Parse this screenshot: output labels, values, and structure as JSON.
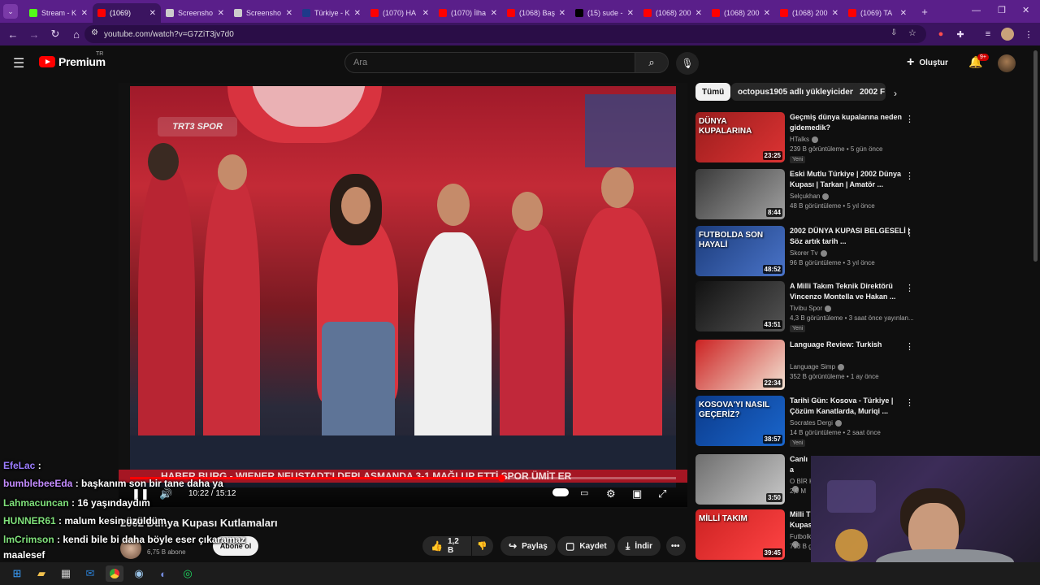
{
  "browser": {
    "tabs": [
      {
        "title": "Stream - K",
        "color": "#53fc18"
      },
      {
        "title": "(1069)",
        "color": "#ff0000",
        "active": true
      },
      {
        "title": "Screensho",
        "color": "#cccccc"
      },
      {
        "title": "Screensho",
        "color": "#cccccc"
      },
      {
        "title": "Türkiye - K",
        "color": "#1e3a8a"
      },
      {
        "title": "(1070) HA",
        "color": "#ff0000"
      },
      {
        "title": "(1070) İlha",
        "color": "#ff0000"
      },
      {
        "title": "(1068) Baş",
        "color": "#ff0000"
      },
      {
        "title": "(15) sude -",
        "color": "#000000"
      },
      {
        "title": "(1068) 200",
        "color": "#ff0000"
      },
      {
        "title": "(1068) 200",
        "color": "#ff0000"
      },
      {
        "title": "(1068) 200",
        "color": "#ff0000"
      },
      {
        "title": "(1069) TA",
        "color": "#ff0000"
      }
    ],
    "url": "youtube.com/watch?v=G7ZiT3jv7d0"
  },
  "header": {
    "logo_text": "Premium",
    "region": "TR",
    "search_placeholder": "Ara",
    "create_label": "Oluştur",
    "notif_badge": "9+"
  },
  "player": {
    "channel_logo": "TRT3 SPOR",
    "ticker": "HABER BURG - WIENER NEUSTADT'I DEPLASMANDA 3-1 MAĞLUP ETTİ   SPOR   ÜMİT ER",
    "time": "10:22 / 15:12",
    "progress": 0.68
  },
  "chat": [
    {
      "user": "EfeLac",
      "msg": "",
      "color": "#9b7cff"
    },
    {
      "user": "bumblebeeEda",
      "msg": "başkanım son bir tane daha ya",
      "color": "#c48cff"
    },
    {
      "user": "Lahmacuncan",
      "msg": "16 yaşındaydım",
      "color": "#7fe07a"
    },
    {
      "user": "HUNNER61",
      "msg": "malum kesin üzüldüm",
      "color": "#7fe07a"
    },
    {
      "user": "lmCrimson",
      "msg": "kendi bile bi daha böyle eser çıkaramaz",
      "color": "#7fe07a"
    },
    {
      "user": "",
      "msg": "maalesef",
      "color": "#ffffff"
    }
  ],
  "video": {
    "title": "2002 Dünya Kupası Kutlamaları",
    "subscribers": "6,75 B abone",
    "subscribe_label": "Abone ol",
    "likes": "1,2 B",
    "share_label": "Paylaş",
    "save_label": "Kaydet",
    "download_label": "İndir"
  },
  "sidebar": {
    "chips": [
      "Tümü",
      "octopus1905 adlı yükleyiciden",
      "2002 F"
    ],
    "recommendations": [
      {
        "title": "Geçmiş dünya kupalarına neden gidemedik?",
        "channel": "HTalks",
        "meta": "239 B görüntüleme • 5 gün önce",
        "badge": "Yeni",
        "duration": "23:25",
        "thumb_text": "DÜNYA KUPALARINA"
      },
      {
        "title": "Eski Mutlu Türkiye | 2002 Dünya Kupası | Tarkan | Amatör ...",
        "channel": "Selçukhan",
        "meta": "48 B görüntüleme • 5 yıl önce",
        "badge": "",
        "duration": "8:44",
        "thumb_text": ""
      },
      {
        "title": "2002 DÜNYA KUPASI BELGESELİ | Söz artık tarih ...",
        "channel": "Skorer Tv",
        "meta": "96 B görüntüleme • 3 yıl önce",
        "badge": "",
        "duration": "48:52",
        "thumb_text": "FUTBOLDA SON HAYALİ"
      },
      {
        "title": "A Milli Takım Teknik Direktörü Vincenzo Montella ve Hakan ...",
        "channel": "Tivibu Spor",
        "meta": "4,3 B görüntüleme • 3 saat önce yayınlan...",
        "badge": "Yeni",
        "duration": "43:51",
        "thumb_text": ""
      },
      {
        "title": "Language Review: Turkish",
        "channel": "Language Simp",
        "meta": "352 B görüntüleme • 1 ay önce",
        "badge": "",
        "duration": "22:34",
        "thumb_text": ""
      },
      {
        "title": "Tarihi Gün: Kosova - Türkiye | Çözüm Kanatlarda, Muriqi ...",
        "channel": "Socrates Dergi",
        "meta": "14 B görüntüleme • 2 saat önce",
        "badge": "Yeni",
        "duration": "38:57",
        "thumb_text": "KOSOVA'YI NASIL GEÇERİZ?"
      },
      {
        "title": "Canlı a askeri",
        "channel": "O BİR K",
        "meta": "2,9 M",
        "badge": "",
        "duration": "3:50",
        "thumb_text": ""
      },
      {
        "title": "Milli T Kupas",
        "channel": "Futbolk",
        "meta": "713 B g",
        "badge": "",
        "duration": "39:45",
        "thumb_text": "MİLLİ TAKIM"
      }
    ]
  },
  "colors": {
    "accent": "#ff0000",
    "browser_frame": "#5a1f8a"
  }
}
